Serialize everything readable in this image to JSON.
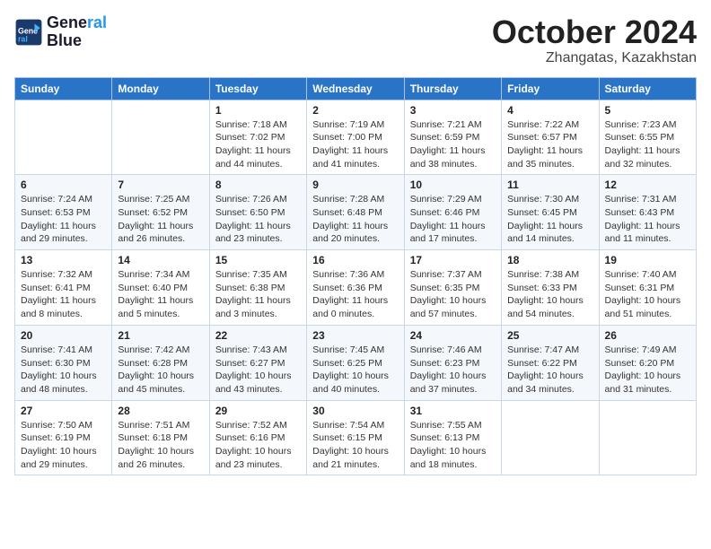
{
  "header": {
    "logo_line1": "General",
    "logo_line2": "Blue",
    "month": "October 2024",
    "location": "Zhangatas, Kazakhstan"
  },
  "days_of_week": [
    "Sunday",
    "Monday",
    "Tuesday",
    "Wednesday",
    "Thursday",
    "Friday",
    "Saturday"
  ],
  "weeks": [
    [
      {
        "day": "",
        "info": ""
      },
      {
        "day": "",
        "info": ""
      },
      {
        "day": "1",
        "info": "Sunrise: 7:18 AM\nSunset: 7:02 PM\nDaylight: 11 hours and 44 minutes."
      },
      {
        "day": "2",
        "info": "Sunrise: 7:19 AM\nSunset: 7:00 PM\nDaylight: 11 hours and 41 minutes."
      },
      {
        "day": "3",
        "info": "Sunrise: 7:21 AM\nSunset: 6:59 PM\nDaylight: 11 hours and 38 minutes."
      },
      {
        "day": "4",
        "info": "Sunrise: 7:22 AM\nSunset: 6:57 PM\nDaylight: 11 hours and 35 minutes."
      },
      {
        "day": "5",
        "info": "Sunrise: 7:23 AM\nSunset: 6:55 PM\nDaylight: 11 hours and 32 minutes."
      }
    ],
    [
      {
        "day": "6",
        "info": "Sunrise: 7:24 AM\nSunset: 6:53 PM\nDaylight: 11 hours and 29 minutes."
      },
      {
        "day": "7",
        "info": "Sunrise: 7:25 AM\nSunset: 6:52 PM\nDaylight: 11 hours and 26 minutes."
      },
      {
        "day": "8",
        "info": "Sunrise: 7:26 AM\nSunset: 6:50 PM\nDaylight: 11 hours and 23 minutes."
      },
      {
        "day": "9",
        "info": "Sunrise: 7:28 AM\nSunset: 6:48 PM\nDaylight: 11 hours and 20 minutes."
      },
      {
        "day": "10",
        "info": "Sunrise: 7:29 AM\nSunset: 6:46 PM\nDaylight: 11 hours and 17 minutes."
      },
      {
        "day": "11",
        "info": "Sunrise: 7:30 AM\nSunset: 6:45 PM\nDaylight: 11 hours and 14 minutes."
      },
      {
        "day": "12",
        "info": "Sunrise: 7:31 AM\nSunset: 6:43 PM\nDaylight: 11 hours and 11 minutes."
      }
    ],
    [
      {
        "day": "13",
        "info": "Sunrise: 7:32 AM\nSunset: 6:41 PM\nDaylight: 11 hours and 8 minutes."
      },
      {
        "day": "14",
        "info": "Sunrise: 7:34 AM\nSunset: 6:40 PM\nDaylight: 11 hours and 5 minutes."
      },
      {
        "day": "15",
        "info": "Sunrise: 7:35 AM\nSunset: 6:38 PM\nDaylight: 11 hours and 3 minutes."
      },
      {
        "day": "16",
        "info": "Sunrise: 7:36 AM\nSunset: 6:36 PM\nDaylight: 11 hours and 0 minutes."
      },
      {
        "day": "17",
        "info": "Sunrise: 7:37 AM\nSunset: 6:35 PM\nDaylight: 10 hours and 57 minutes."
      },
      {
        "day": "18",
        "info": "Sunrise: 7:38 AM\nSunset: 6:33 PM\nDaylight: 10 hours and 54 minutes."
      },
      {
        "day": "19",
        "info": "Sunrise: 7:40 AM\nSunset: 6:31 PM\nDaylight: 10 hours and 51 minutes."
      }
    ],
    [
      {
        "day": "20",
        "info": "Sunrise: 7:41 AM\nSunset: 6:30 PM\nDaylight: 10 hours and 48 minutes."
      },
      {
        "day": "21",
        "info": "Sunrise: 7:42 AM\nSunset: 6:28 PM\nDaylight: 10 hours and 45 minutes."
      },
      {
        "day": "22",
        "info": "Sunrise: 7:43 AM\nSunset: 6:27 PM\nDaylight: 10 hours and 43 minutes."
      },
      {
        "day": "23",
        "info": "Sunrise: 7:45 AM\nSunset: 6:25 PM\nDaylight: 10 hours and 40 minutes."
      },
      {
        "day": "24",
        "info": "Sunrise: 7:46 AM\nSunset: 6:23 PM\nDaylight: 10 hours and 37 minutes."
      },
      {
        "day": "25",
        "info": "Sunrise: 7:47 AM\nSunset: 6:22 PM\nDaylight: 10 hours and 34 minutes."
      },
      {
        "day": "26",
        "info": "Sunrise: 7:49 AM\nSunset: 6:20 PM\nDaylight: 10 hours and 31 minutes."
      }
    ],
    [
      {
        "day": "27",
        "info": "Sunrise: 7:50 AM\nSunset: 6:19 PM\nDaylight: 10 hours and 29 minutes."
      },
      {
        "day": "28",
        "info": "Sunrise: 7:51 AM\nSunset: 6:18 PM\nDaylight: 10 hours and 26 minutes."
      },
      {
        "day": "29",
        "info": "Sunrise: 7:52 AM\nSunset: 6:16 PM\nDaylight: 10 hours and 23 minutes."
      },
      {
        "day": "30",
        "info": "Sunrise: 7:54 AM\nSunset: 6:15 PM\nDaylight: 10 hours and 21 minutes."
      },
      {
        "day": "31",
        "info": "Sunrise: 7:55 AM\nSunset: 6:13 PM\nDaylight: 10 hours and 18 minutes."
      },
      {
        "day": "",
        "info": ""
      },
      {
        "day": "",
        "info": ""
      }
    ]
  ]
}
